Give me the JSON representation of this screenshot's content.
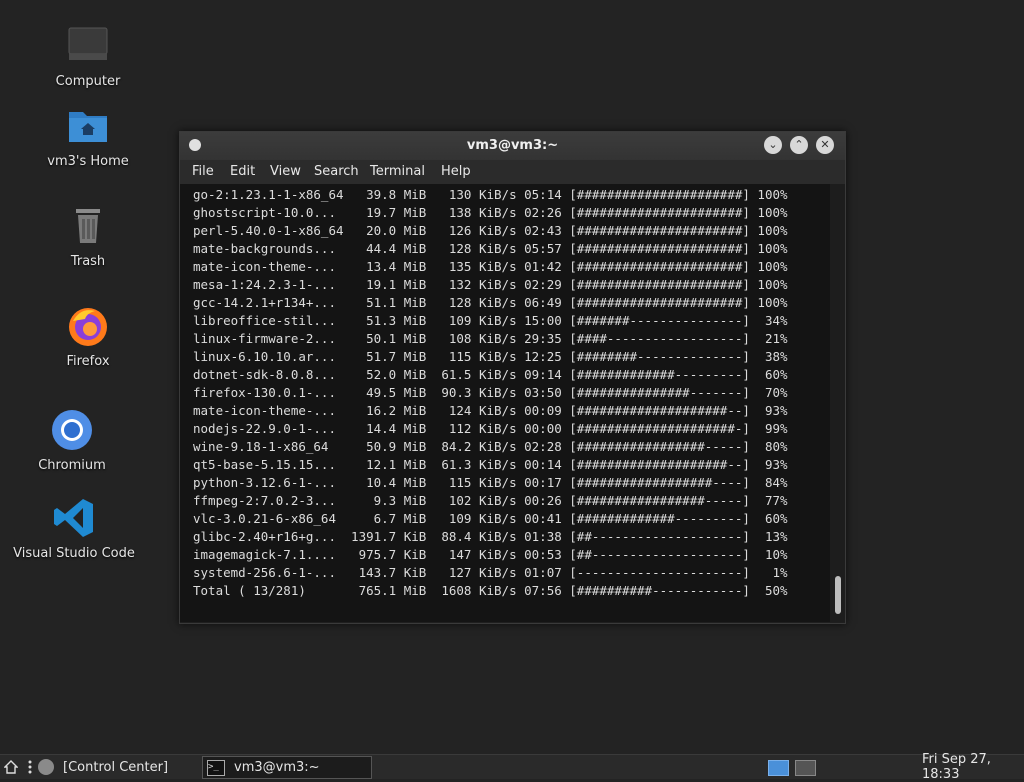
{
  "desktop": {
    "icons": [
      {
        "label": "Computer",
        "icon": "computer-icon"
      },
      {
        "label": "vm3's Home",
        "icon": "home-folder-icon"
      },
      {
        "label": "Trash",
        "icon": "trash-icon"
      },
      {
        "label": "Firefox",
        "icon": "firefox-icon"
      },
      {
        "label": "Chromium",
        "icon": "chromium-icon"
      },
      {
        "label": "Visual Studio Code",
        "icon": "vscode-icon"
      }
    ]
  },
  "window": {
    "title": "vm3@vm3:~",
    "menu": [
      "File",
      "Edit",
      "View",
      "Search",
      "Terminal",
      "Help"
    ],
    "lines": [
      "go-2:1.23.1-1-x86_64   39.8 MiB   130 KiB/s 05:14 [######################] 100%",
      "ghostscript-10.0...    19.7 MiB   138 KiB/s 02:26 [######################] 100%",
      "perl-5.40.0-1-x86_64   20.0 MiB   126 KiB/s 02:43 [######################] 100%",
      "mate-backgrounds...    44.4 MiB   128 KiB/s 05:57 [######################] 100%",
      "mate-icon-theme-...    13.4 MiB   135 KiB/s 01:42 [######################] 100%",
      "mesa-1:24.2.3-1-...    19.1 MiB   132 KiB/s 02:29 [######################] 100%",
      "gcc-14.2.1+r134+...    51.1 MiB   128 KiB/s 06:49 [######################] 100%",
      "libreoffice-stil...    51.3 MiB   109 KiB/s 15:00 [#######---------------]  34%",
      "linux-firmware-2...    50.1 MiB   108 KiB/s 29:35 [####------------------]  21%",
      "linux-6.10.10.ar...    51.7 MiB   115 KiB/s 12:25 [########--------------]  38%",
      "dotnet-sdk-8.0.8...    52.0 MiB  61.5 KiB/s 09:14 [#############---------]  60%",
      "firefox-130.0.1-...    49.5 MiB  90.3 KiB/s 03:50 [###############-------]  70%",
      "mate-icon-theme-...    16.2 MiB   124 KiB/s 00:09 [####################--]  93%",
      "nodejs-22.9.0-1-...    14.4 MiB   112 KiB/s 00:00 [#####################-]  99%",
      "wine-9.18-1-x86_64     50.9 MiB  84.2 KiB/s 02:28 [#################-----]  80%",
      "qt5-base-5.15.15...    12.1 MiB  61.3 KiB/s 00:14 [####################--]  93%",
      "python-3.12.6-1-...    10.4 MiB   115 KiB/s 00:17 [##################----]  84%",
      "ffmpeg-2:7.0.2-3...     9.3 MiB   102 KiB/s 00:26 [#################-----]  77%",
      "vlc-3.0.21-6-x86_64     6.7 MiB   109 KiB/s 00:41 [#############---------]  60%",
      "glibc-2.40+r16+g...  1391.7 KiB  88.4 KiB/s 01:38 [##--------------------]  13%",
      "imagemagick-7.1....   975.7 KiB   147 KiB/s 00:53 [##--------------------]  10%",
      "systemd-256.6-1-...   143.7 KiB   127 KiB/s 01:07 [----------------------]   1%",
      "Total ( 13/281)       765.1 MiB  1608 KiB/s 07:56 [##########------------]  50%"
    ]
  },
  "taskbar": {
    "control_center": "[Control Center]",
    "task_label": "vm3@vm3:~",
    "clock": "Fri Sep 27, 18:33"
  },
  "colors": {
    "desktop_bg": "#232323",
    "terminal_bg": "#141414",
    "folder_blue": "#3d8fd6",
    "vscode_blue": "#1f8ad2",
    "workspace_active": "#4a90d9"
  }
}
